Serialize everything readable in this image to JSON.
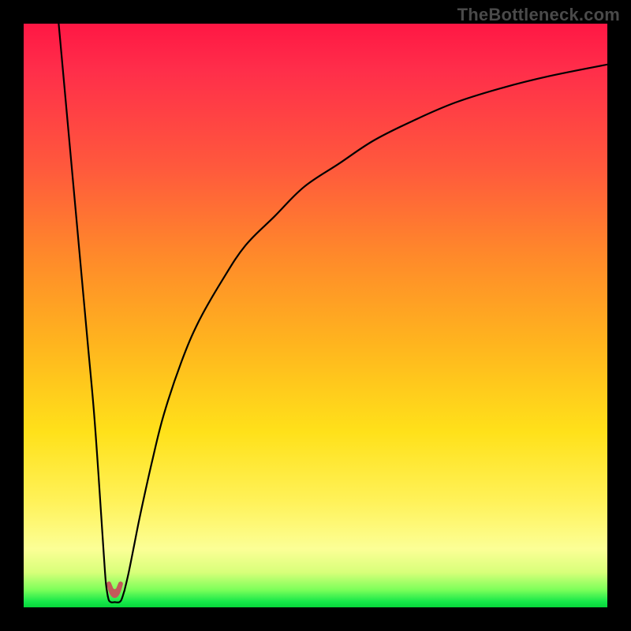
{
  "watermark": "TheBottleneck.com",
  "chart_data": {
    "type": "line",
    "title": "",
    "xlabel": "",
    "ylabel": "",
    "xlim": [
      0,
      100
    ],
    "ylim": [
      0,
      100
    ],
    "grid": false,
    "legend": false,
    "series": [
      {
        "name": "bottleneck-curve-left",
        "x": [
          6,
          7,
          8,
          9,
          10,
          11,
          12,
          12.8,
          13.4,
          13.8,
          14.1,
          14.4
        ],
        "y": [
          100,
          89,
          78,
          67,
          56,
          45,
          34,
          23,
          14,
          8,
          4,
          2
        ]
      },
      {
        "name": "bottleneck-curve-valley",
        "x": [
          14.4,
          14.6,
          14.9,
          15.2,
          15.6,
          16.0,
          16.4,
          16.7,
          17.0,
          17.3
        ],
        "y": [
          2,
          1.2,
          0.9,
          0.85,
          0.9,
          0.85,
          0.9,
          1.2,
          2,
          3
        ]
      },
      {
        "name": "bottleneck-curve-right",
        "x": [
          17.3,
          18,
          19,
          20,
          22,
          24,
          27,
          30,
          34,
          38,
          43,
          48,
          54,
          60,
          67,
          74,
          82,
          90,
          100
        ],
        "y": [
          3,
          6,
          11,
          16,
          25,
          33,
          42,
          49,
          56,
          62,
          67,
          72,
          76,
          80,
          83.5,
          86.5,
          89,
          91,
          93
        ]
      },
      {
        "name": "valley-blob",
        "x": [
          14.6,
          15.0,
          15.4,
          15.8,
          16.2,
          16.6
        ],
        "y": [
          3.2,
          2.2,
          1.9,
          1.9,
          2.2,
          3.2
        ]
      }
    ],
    "colors": {
      "curve": "#000000",
      "valley_blob": "#c45a5a",
      "gradient_top": "#ff1744",
      "gradient_mid": "#ffe11a",
      "gradient_bottom": "#06d63a"
    }
  }
}
